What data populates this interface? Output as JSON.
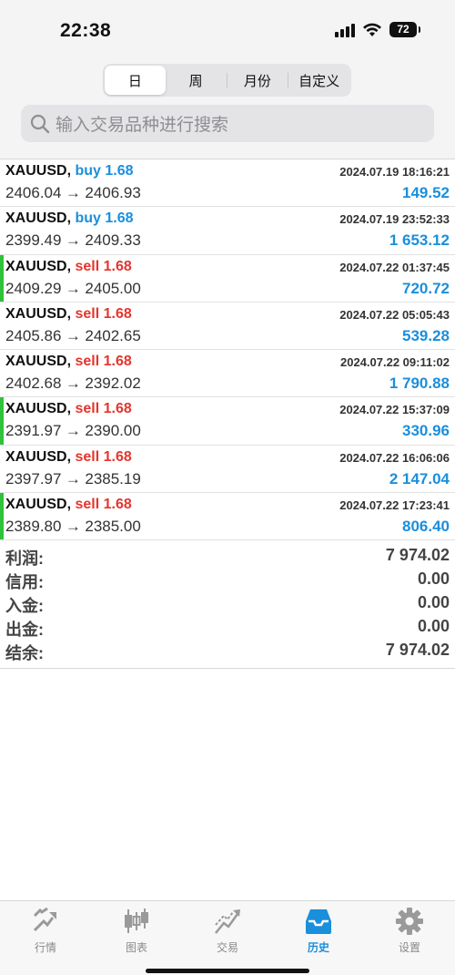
{
  "status_bar": {
    "time": "22:38",
    "battery": "72"
  },
  "period_tabs": [
    {
      "label": "日",
      "active": true
    },
    {
      "label": "周",
      "active": false
    },
    {
      "label": "月份",
      "active": false
    },
    {
      "label": "自定义",
      "active": false
    }
  ],
  "search": {
    "placeholder": "输入交易品种进行搜索"
  },
  "trades": [
    {
      "symbol": "XAUUSD,",
      "side": "buy",
      "volume": "1.68",
      "open": "2406.04",
      "close": "2406.93",
      "arrow": "→",
      "time": "2024.07.19 18:16:21",
      "profit": "149.52",
      "marked": false
    },
    {
      "symbol": "XAUUSD,",
      "side": "buy",
      "volume": "1.68",
      "open": "2399.49",
      "close": "2409.33",
      "arrow": "→",
      "time": "2024.07.19 23:52:33",
      "profit": "1 653.12",
      "marked": false
    },
    {
      "symbol": "XAUUSD,",
      "side": "sell",
      "volume": "1.68",
      "open": "2409.29",
      "close": "2405.00",
      "arrow": "→",
      "time": "2024.07.22 01:37:45",
      "profit": "720.72",
      "marked": true
    },
    {
      "symbol": "XAUUSD,",
      "side": "sell",
      "volume": "1.68",
      "open": "2405.86",
      "close": "2402.65",
      "arrow": "→",
      "time": "2024.07.22 05:05:43",
      "profit": "539.28",
      "marked": false
    },
    {
      "symbol": "XAUUSD,",
      "side": "sell",
      "volume": "1.68",
      "open": "2402.68",
      "close": "2392.02",
      "arrow": "→",
      "time": "2024.07.22 09:11:02",
      "profit": "1 790.88",
      "marked": false
    },
    {
      "symbol": "XAUUSD,",
      "side": "sell",
      "volume": "1.68",
      "open": "2391.97",
      "close": "2390.00",
      "arrow": "→",
      "time": "2024.07.22 15:37:09",
      "profit": "330.96",
      "marked": true
    },
    {
      "symbol": "XAUUSD,",
      "side": "sell",
      "volume": "1.68",
      "open": "2397.97",
      "close": "2385.19",
      "arrow": "→",
      "time": "2024.07.22 16:06:06",
      "profit": "2 147.04",
      "marked": false
    },
    {
      "symbol": "XAUUSD,",
      "side": "sell",
      "volume": "1.68",
      "open": "2389.80",
      "close": "2385.00",
      "arrow": "→",
      "time": "2024.07.22 17:23:41",
      "profit": "806.40",
      "marked": true
    }
  ],
  "summary": [
    {
      "label": "利润:",
      "value": "7 974.02"
    },
    {
      "label": "信用:",
      "value": "0.00"
    },
    {
      "label": "入金:",
      "value": "0.00"
    },
    {
      "label": "出金:",
      "value": "0.00"
    },
    {
      "label": "结余:",
      "value": "7 974.02"
    }
  ],
  "tab_bar": [
    {
      "label": "行情",
      "icon": "quotes-icon",
      "active": false
    },
    {
      "label": "图表",
      "icon": "chart-icon",
      "active": false
    },
    {
      "label": "交易",
      "icon": "trade-icon",
      "active": false
    },
    {
      "label": "历史",
      "icon": "history-icon",
      "active": true
    },
    {
      "label": "设置",
      "icon": "settings-icon",
      "active": false
    }
  ],
  "colors": {
    "buy": "#1a8fdc",
    "sell": "#e5352e",
    "profit": "#1a8fdc",
    "marker": "#2fc23a",
    "active_tab": "#1a8fdc"
  }
}
